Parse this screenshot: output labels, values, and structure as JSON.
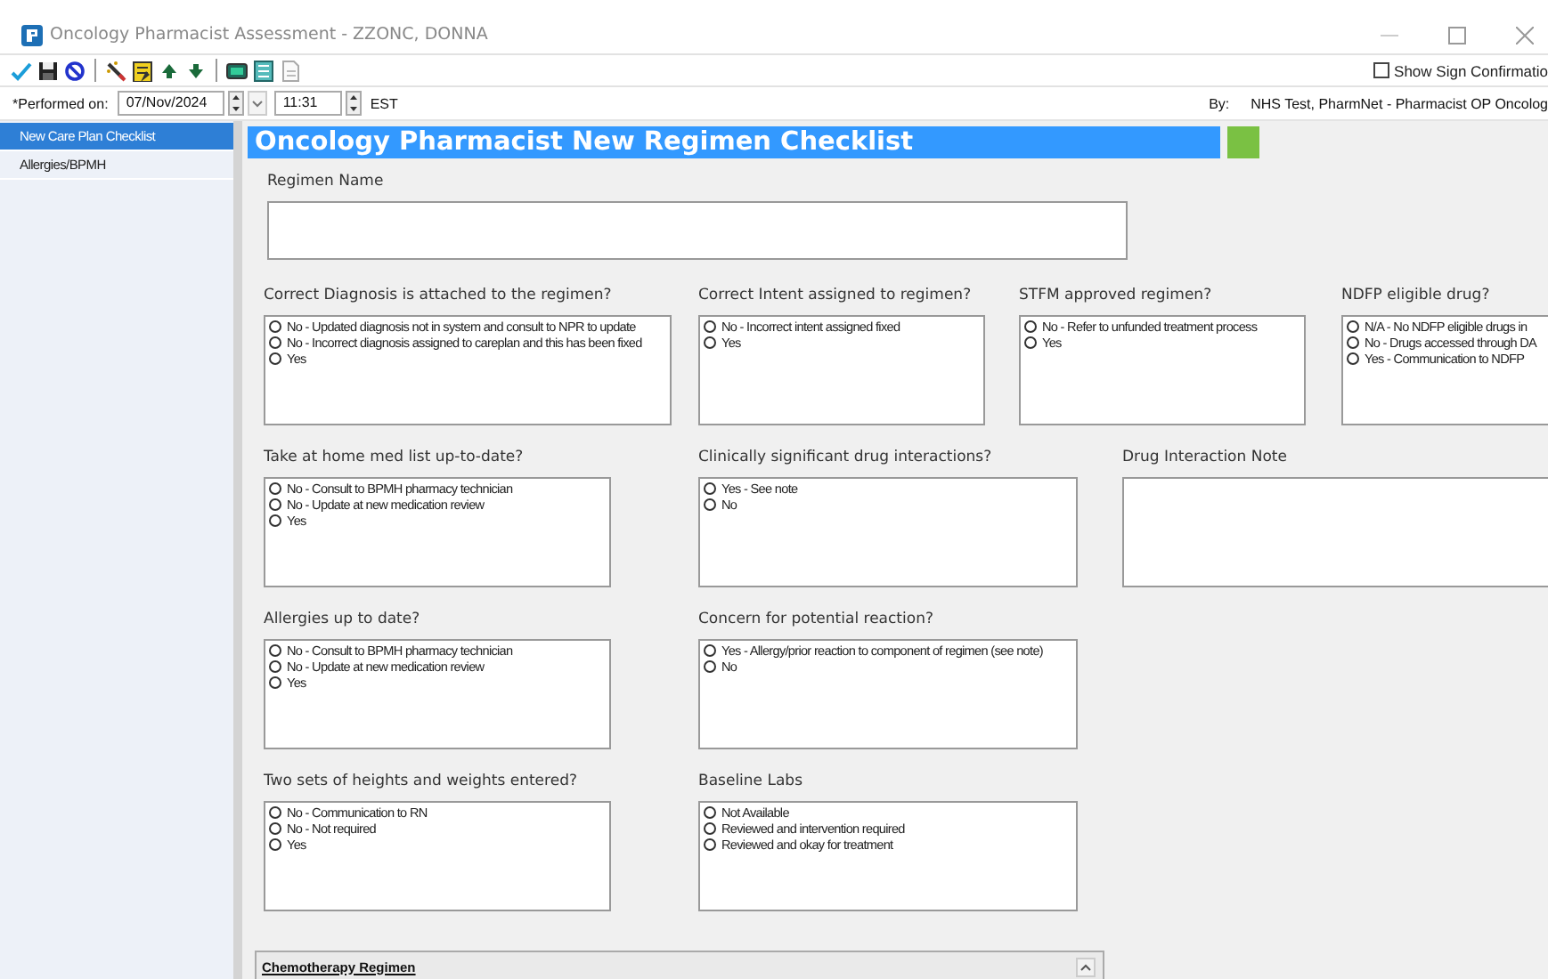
{
  "window": {
    "title": "Oncology Pharmacist Assessment - ZZONC, DONNA"
  },
  "toolbar": {
    "sign_confirmation": {
      "label": "Show Sign Confirmatio",
      "checked": false
    }
  },
  "performed": {
    "label": "*Performed on:",
    "date": "07/Nov/2024",
    "time": "11:31",
    "zone": "EST",
    "by_label": "By:",
    "by_value": "NHS Test, PharmNet - Pharmacist OP Oncolog"
  },
  "sidebar": {
    "items": [
      {
        "label": "New Care Plan Checklist",
        "selected": true
      },
      {
        "label": "Allergies/BPMH",
        "selected": false
      }
    ]
  },
  "form": {
    "title": "Oncology Pharmacist New Regimen Checklist",
    "regimen_name": {
      "label": "Regimen Name"
    },
    "rows": [
      [
        {
          "kind": "radio",
          "label": "Correct Diagnosis is attached to the regimen?",
          "options": [
            {
              "label": "No - Updated diagnosis not in system and consult to NPR to update",
              "selected": false
            },
            {
              "label": "No - Incorrect diagnosis assigned to careplan and this has been fixed",
              "selected": false
            },
            {
              "label": "Yes",
              "selected": false
            }
          ]
        },
        {
          "kind": "radio",
          "label": "Correct Intent assigned to regimen?",
          "options": [
            {
              "label": "No - Incorrect intent assigned fixed",
              "selected": false
            },
            {
              "label": "Yes",
              "selected": false
            }
          ]
        },
        {
          "kind": "radio",
          "label": "STFM approved regimen?",
          "options": [
            {
              "label": "No - Refer to unfunded treatment process",
              "selected": false
            },
            {
              "label": "Yes",
              "selected": false
            }
          ]
        },
        {
          "kind": "radio",
          "label": "NDFP eligible drug?",
          "options": [
            {
              "label": "N/A - No NDFP eligible drugs in",
              "selected": false
            },
            {
              "label": "No - Drugs accessed through DA",
              "selected": false
            },
            {
              "label": "Yes - Communication to NDFP",
              "selected": false
            }
          ]
        }
      ],
      [
        {
          "kind": "radio",
          "label": "Take at home med list up-to-date?",
          "options": [
            {
              "label": "No - Consult to BPMH pharmacy technician",
              "selected": false
            },
            {
              "label": "No - Update at new medication review",
              "selected": false
            },
            {
              "label": "Yes",
              "selected": false
            }
          ]
        },
        {
          "kind": "radio",
          "label": "Clinically significant drug interactions?",
          "options": [
            {
              "label": "Yes - See note",
              "selected": false
            },
            {
              "label": "No",
              "selected": false
            }
          ]
        },
        {
          "kind": "note",
          "label": "Drug Interaction Note"
        }
      ],
      [
        {
          "kind": "radio",
          "label": "Allergies up to date?",
          "options": [
            {
              "label": "No - Consult to BPMH pharmacy technician",
              "selected": false
            },
            {
              "label": "No - Update at new medication review",
              "selected": false
            },
            {
              "label": "Yes",
              "selected": false
            }
          ]
        },
        {
          "kind": "radio",
          "label": "Concern for potential reaction?",
          "options": [
            {
              "label": "Yes - Allergy/prior reaction to component of regimen (see note)",
              "selected": false
            },
            {
              "label": "No",
              "selected": false
            }
          ]
        }
      ],
      [
        {
          "kind": "radio",
          "label": "Two sets of heights and weights entered?",
          "options": [
            {
              "label": "No - Communication to RN",
              "selected": false
            },
            {
              "label": "No - Not required",
              "selected": false
            },
            {
              "label": "Yes",
              "selected": false
            }
          ]
        },
        {
          "kind": "radio",
          "label": "Baseline Labs",
          "options": [
            {
              "label": "Not Available",
              "selected": false
            },
            {
              "label": "Reviewed and intervention required",
              "selected": false
            },
            {
              "label": "Reviewed and okay for treatment",
              "selected": false
            }
          ]
        }
      ]
    ],
    "chemotherapy_regimen": {
      "label": "Chemotherapy Regimen"
    }
  }
}
